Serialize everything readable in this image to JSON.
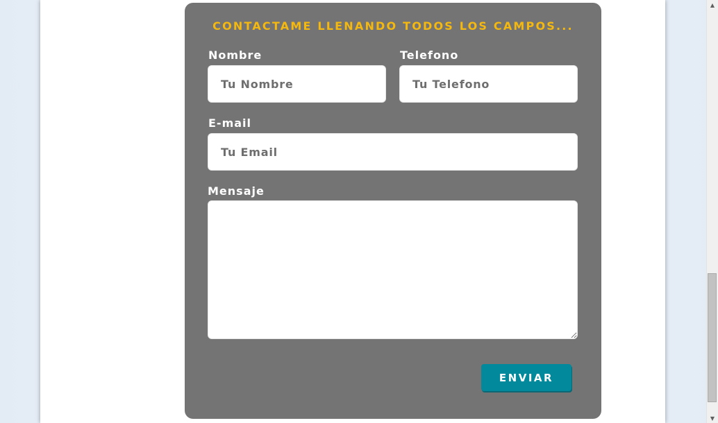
{
  "form": {
    "title": "CONTACTAME LLENANDO TODOS LOS CAMPOS...",
    "name_label": "Nombre",
    "name_placeholder": "Tu Nombre",
    "name_value": "",
    "phone_label": "Telefono",
    "phone_placeholder": "Tu Telefono",
    "phone_value": "",
    "email_label": "E-mail",
    "email_placeholder": "Tu Email",
    "email_value": "",
    "message_label": "Mensaje",
    "message_value": "",
    "submit_label": "ENVIAR"
  },
  "colors": {
    "card_background": "#747474",
    "title_accent": "#f5b80f",
    "button_background": "#03899c",
    "page_background": "#edf2f9"
  },
  "icons": {
    "scroll_up": "scroll-up-arrow-icon",
    "scroll_down": "scroll-down-arrow-icon"
  }
}
